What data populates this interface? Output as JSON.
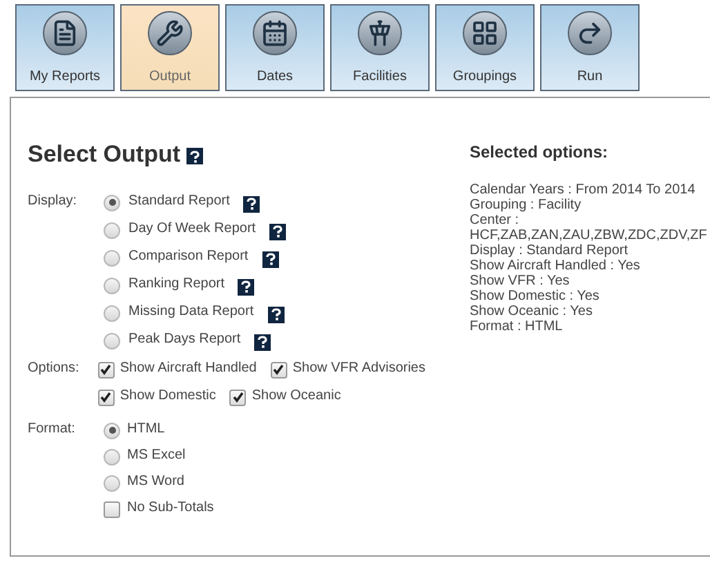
{
  "tabs": [
    {
      "label": "My Reports",
      "kind": "reports",
      "selected": false
    },
    {
      "label": "Output",
      "kind": "tools",
      "selected": true
    },
    {
      "label": "Dates",
      "kind": "calendar",
      "selected": false
    },
    {
      "label": "Facilities",
      "kind": "tower",
      "selected": false
    },
    {
      "label": "Groupings",
      "kind": "groups",
      "selected": false
    },
    {
      "label": "Run",
      "kind": "run",
      "selected": false
    }
  ],
  "title": "Select Output",
  "display": {
    "label": "Display:",
    "options": [
      {
        "label": "Standard Report",
        "selected": true
      },
      {
        "label": "Day Of Week Report",
        "selected": false
      },
      {
        "label": "Comparison Report",
        "selected": false
      },
      {
        "label": "Ranking Report",
        "selected": false
      },
      {
        "label": "Missing Data Report",
        "selected": false
      },
      {
        "label": "Peak Days Report",
        "selected": false
      }
    ]
  },
  "options": {
    "label": "Options:",
    "rows": [
      [
        {
          "label": "Show Aircraft Handled",
          "checked": true
        },
        {
          "label": "Show VFR Advisories",
          "checked": true
        }
      ],
      [
        {
          "label": "Show Domestic",
          "checked": true
        },
        {
          "label": "Show Oceanic",
          "checked": true
        }
      ]
    ]
  },
  "format": {
    "label": "Format:",
    "options": [
      {
        "kind": "radio",
        "label": "HTML",
        "selected": true
      },
      {
        "kind": "radio",
        "label": "MS Excel",
        "selected": false
      },
      {
        "kind": "radio",
        "label": "MS Word",
        "selected": false
      },
      {
        "kind": "checkbox",
        "label": "No Sub-Totals",
        "checked": false
      }
    ]
  },
  "selected_options": {
    "title": "Selected options:",
    "lines": [
      "Calendar Years : From 2014 To 2014",
      "Grouping : Facility",
      "Center :",
      "HCF,ZAB,ZAN,ZAU,ZBW,ZDC,ZDV,ZF",
      "Display : Standard Report",
      "Show Aircraft Handled : Yes",
      "Show VFR : Yes",
      "Show Domestic : Yes",
      "Show Oceanic : Yes",
      "Format : HTML"
    ]
  }
}
